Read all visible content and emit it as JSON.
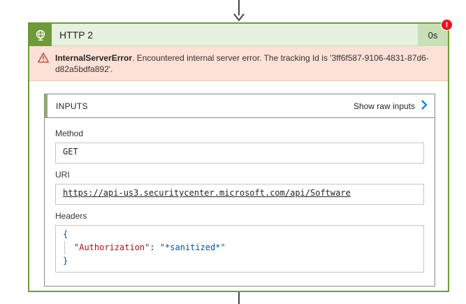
{
  "action": {
    "title": "HTTP 2",
    "duration": "0s",
    "status_badge": "!",
    "colors": {
      "success_green": "#6f9a3a",
      "error_red": "#e81123",
      "error_bg": "#fde0d6"
    }
  },
  "error": {
    "code": "InternalServerError",
    "message": ". Encountered internal server error. The tracking Id is '3ff6f587-9106-4831-87d6-d82a5bdfa892'."
  },
  "inputs": {
    "title": "INPUTS",
    "show_raw_label": "Show raw inputs",
    "fields": {
      "method": {
        "label": "Method",
        "value": "GET"
      },
      "uri": {
        "label": "URI",
        "value": "https://api-us3.securitycenter.microsoft.com/api/Software"
      },
      "headers": {
        "label": "Headers",
        "open_brace": "{",
        "close_brace": "}",
        "entries": [
          {
            "key": "\"Authorization\"",
            "sep": ": ",
            "value": "\"*sanitized*\""
          }
        ]
      }
    }
  },
  "icons": {
    "header_icon": "globe-icon",
    "warning_icon": "warning-icon",
    "chevron_icon": "chevron-right-icon",
    "arrow_icon": "arrow-down-icon"
  }
}
